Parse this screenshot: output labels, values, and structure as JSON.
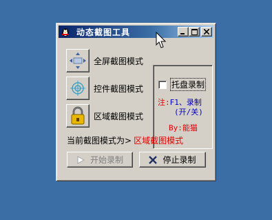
{
  "window": {
    "title": "动态截图工具",
    "icon": "penguin-app-icon"
  },
  "titlebar_buttons": [
    {
      "name": "minimize-button",
      "icon": "minimize-icon"
    },
    {
      "name": "maximize-button",
      "icon": "maximize-icon"
    },
    {
      "name": "close-button",
      "icon": "close-icon"
    }
  ],
  "modes": [
    {
      "label": "全屏截图模式",
      "icon": "fullscreen-capture-icon"
    },
    {
      "label": "控件截图模式",
      "icon": "target-crosshair-icon"
    },
    {
      "label": "区域截图模式",
      "icon": "padlock-icon"
    }
  ],
  "tray": {
    "label": "托盘录制",
    "checked": false
  },
  "note": {
    "prefix": "注:",
    "hotkey": "F1、录制",
    "toggle": "(开/关)"
  },
  "author": "By:能猫",
  "current_mode": {
    "prefix": "当前截图模式为>",
    "value": "区域截图模式"
  },
  "buttons": {
    "start": {
      "label": "开始录制",
      "enabled": false,
      "icon": "play-icon"
    },
    "stop": {
      "label": "停止录制",
      "enabled": true,
      "icon": "x-stop-icon"
    }
  },
  "colors": {
    "desktop": "#3a6ea5",
    "window": "#d4d0c8",
    "accent_red": "#e00000",
    "accent_blue": "#0000c0",
    "titlebar_start": "#0a246a"
  }
}
